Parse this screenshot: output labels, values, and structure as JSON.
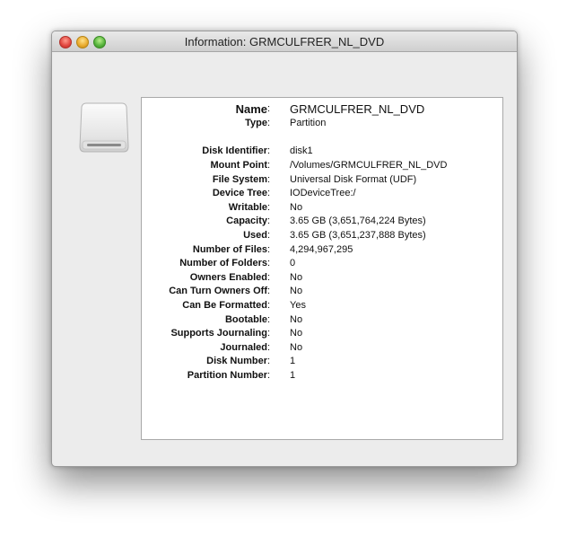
{
  "window": {
    "title": "Information: GRMCULFRER_NL_DVD"
  },
  "icon": "external-disk-icon",
  "info": [
    {
      "label": "Name",
      "value": "GRMCULFRER_NL_DVD"
    },
    {
      "label": "Type",
      "value": "Partition"
    },
    {
      "label": "Disk Identifier",
      "value": "disk1"
    },
    {
      "label": "Mount Point",
      "value": "/Volumes/GRMCULFRER_NL_DVD"
    },
    {
      "label": "File System",
      "value": "Universal Disk Format (UDF)"
    },
    {
      "label": "Device Tree",
      "value": "IODeviceTree:/"
    },
    {
      "label": "Writable",
      "value": "No"
    },
    {
      "label": "Capacity",
      "value": "3.65 GB (3,651,764,224 Bytes)"
    },
    {
      "label": "Used",
      "value": "3.65 GB (3,651,237,888 Bytes)"
    },
    {
      "label": "Number of Files",
      "value": "4,294,967,295"
    },
    {
      "label": "Number of Folders",
      "value": "0"
    },
    {
      "label": "Owners Enabled",
      "value": "No"
    },
    {
      "label": "Can Turn Owners Off",
      "value": "No"
    },
    {
      "label": "Can Be Formatted",
      "value": "Yes"
    },
    {
      "label": "Bootable",
      "value": "No"
    },
    {
      "label": "Supports Journaling",
      "value": "No"
    },
    {
      "label": "Journaled",
      "value": "No"
    },
    {
      "label": "Disk Number",
      "value": "1"
    },
    {
      "label": "Partition Number",
      "value": "1"
    }
  ]
}
